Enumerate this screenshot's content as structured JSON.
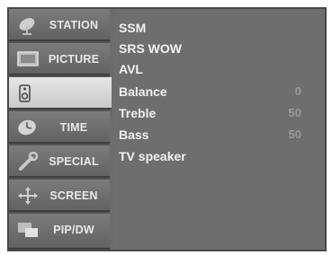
{
  "sidebar": {
    "items": [
      {
        "label": "STATION",
        "icon": "satellite-dish-icon"
      },
      {
        "label": "PICTURE",
        "icon": "tv-screen-icon"
      },
      {
        "label": "",
        "icon": "speaker-icon",
        "active": true
      },
      {
        "label": "TIME",
        "icon": "clock-icon"
      },
      {
        "label": "SPECIAL",
        "icon": "wrench-icon"
      },
      {
        "label": "SCREEN",
        "icon": "move-arrows-icon"
      },
      {
        "label": "PIP/DW",
        "icon": "pip-windows-icon"
      }
    ]
  },
  "menu": {
    "items": [
      {
        "label": "SSM",
        "value": ""
      },
      {
        "label": "SRS WOW",
        "value": ""
      },
      {
        "label": "AVL",
        "value": ""
      },
      {
        "label": "Balance",
        "value": "0"
      },
      {
        "label": "Treble",
        "value": "50"
      },
      {
        "label": "Bass",
        "value": "50"
      },
      {
        "label": "TV speaker",
        "value": ""
      }
    ]
  },
  "colors": {
    "panel": "#6e6e6e",
    "sidebar": "#545454",
    "active_tab": "#dcdcdc",
    "text": "#f2f2f2",
    "value_text": "#9a9a9a"
  }
}
